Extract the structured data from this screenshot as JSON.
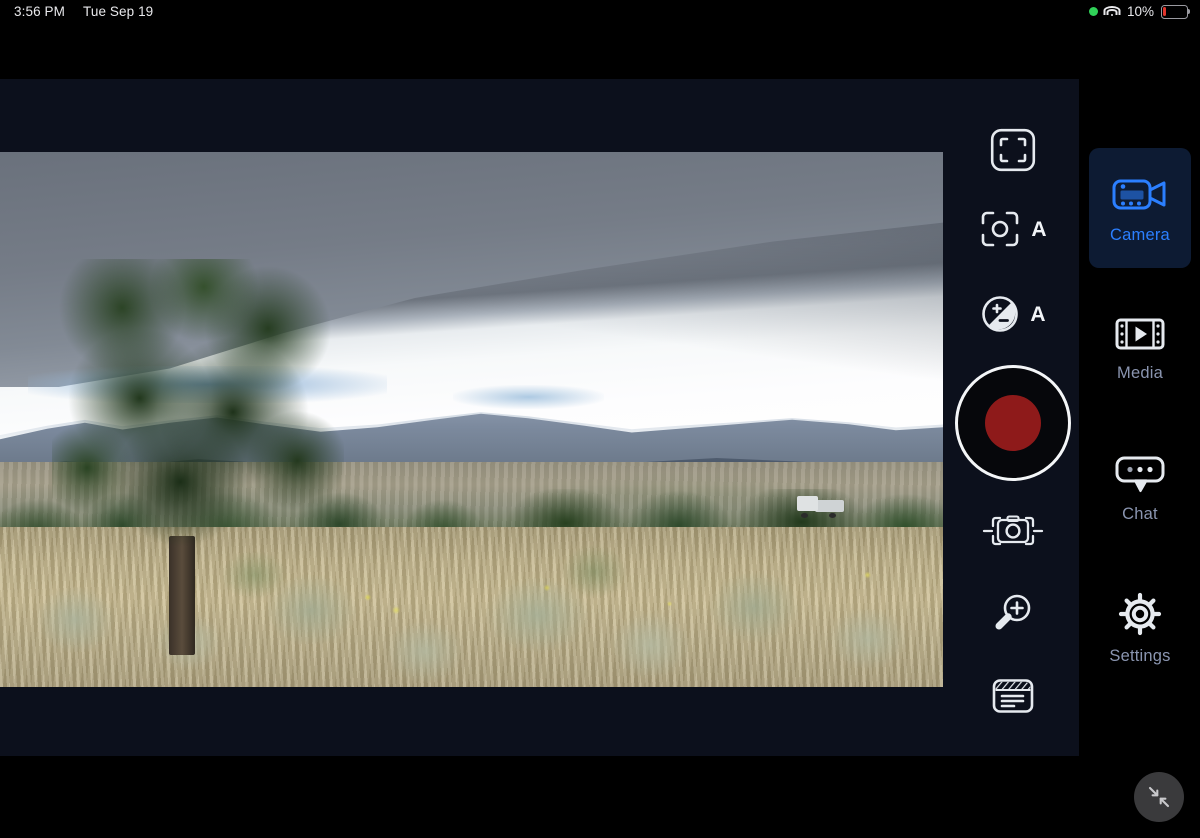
{
  "status_bar": {
    "time": "3:56 PM",
    "date": "Tue Sep 19",
    "battery_percent": "10%",
    "battery_level": 10,
    "recording_indicator": "green-dot",
    "wifi": "wifi-icon",
    "colors": {
      "recording_dot": "#30d158",
      "battery_fill": "#e2352c",
      "text": "#e9e9ec"
    }
  },
  "viewfinder": {
    "scene_description": "Live camera preview of a high-desert landscape: dark juniper tree at left, snow-capped mountain range under a dramatic gray shelf cloud with bright white sky, dry grassland with sagebrush in the foreground and a white pickup truck parked mid-ground.",
    "aspect": "16:9"
  },
  "camera_controls": [
    {
      "id": "framing",
      "icon": "frame-guides-icon",
      "label": "",
      "mode": ""
    },
    {
      "id": "focus",
      "icon": "focus-target-icon",
      "label": "",
      "mode": "A"
    },
    {
      "id": "exposure",
      "icon": "exposure-compensation-icon",
      "label": "",
      "mode": "A"
    },
    {
      "id": "record",
      "icon": "record-button-icon",
      "label": "",
      "mode": ""
    },
    {
      "id": "snapshot",
      "icon": "camera-snapshot-icon",
      "label": "",
      "mode": ""
    },
    {
      "id": "zoom",
      "icon": "magnifier-plus-icon",
      "label": "",
      "mode": ""
    },
    {
      "id": "notes",
      "icon": "notes-card-icon",
      "label": "",
      "mode": ""
    }
  ],
  "record_button": {
    "state": "idle",
    "ring_color": "#f4f6f8",
    "inner_color": "#8e1a1a"
  },
  "tabs": [
    {
      "id": "camera",
      "label": "Camera",
      "icon": "camcorder-icon",
      "active": true
    },
    {
      "id": "media",
      "label": "Media",
      "icon": "film-play-icon",
      "active": false
    },
    {
      "id": "chat",
      "label": "Chat",
      "icon": "chat-bubble-icon",
      "active": false
    },
    {
      "id": "settings",
      "label": "Settings",
      "icon": "gear-icon",
      "active": false
    }
  ],
  "floating_action": {
    "id": "collapse",
    "icon": "collapse-arrows-icon"
  },
  "theme": {
    "panel_background": "#0c101c",
    "page_background": "#000000",
    "accent_blue": "#2b7fff",
    "active_tab_background": "#0d1b33",
    "inactive_label": "#8a95b0",
    "icon_stroke": "#e6eaef"
  }
}
